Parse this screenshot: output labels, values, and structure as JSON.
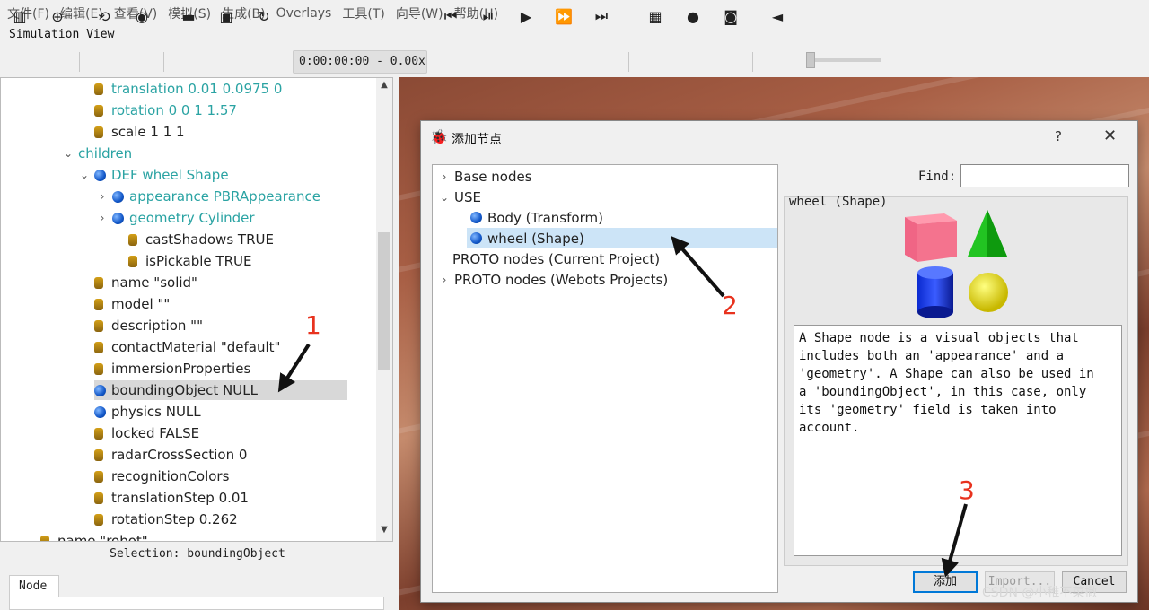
{
  "menu": [
    "文件(F)",
    "编辑(E)",
    "查看(V)",
    "模拟(S)",
    "生成(B)",
    "Overlays",
    "工具(T)",
    "向导(W)",
    "帮助(H)"
  ],
  "simulation_view_title": "Simulation View",
  "toolbar": {
    "time": "0:00:00:00 - 0.00x",
    "icons": [
      "toggle-panel-icon",
      "add-node-icon",
      "reset-view-icon",
      "eye-icon",
      "open-folder-icon",
      "save-icon",
      "reload-icon",
      "step-back-icon",
      "step-icon",
      "play-icon",
      "fast-forward-icon",
      "fastest-icon",
      "record-movie-icon",
      "record-icon",
      "screenshot-icon",
      "mute-icon"
    ]
  },
  "scene_tree": {
    "rows": [
      {
        "text": "translation 0.01 0.0975 0",
        "kind": "field",
        "teal": true
      },
      {
        "text": "rotation 0 0 1 1.57",
        "kind": "field",
        "teal": true
      },
      {
        "text": "scale 1 1 1",
        "kind": "field",
        "teal": false
      },
      {
        "text": "children",
        "kind": "chevron-open",
        "teal": true
      },
      {
        "text": "DEF wheel Shape",
        "kind": "node-open",
        "teal": true
      },
      {
        "text": "appearance PBRAppearance",
        "kind": "node-closed",
        "teal": true
      },
      {
        "text": "geometry Cylinder",
        "kind": "node-closed",
        "teal": true
      },
      {
        "text": "castShadows TRUE",
        "kind": "field",
        "teal": false
      },
      {
        "text": "isPickable TRUE",
        "kind": "field",
        "teal": false
      },
      {
        "text": "name \"solid\"",
        "kind": "field",
        "teal": false
      },
      {
        "text": "model \"\"",
        "kind": "field",
        "teal": false
      },
      {
        "text": "description \"\"",
        "kind": "field",
        "teal": false
      },
      {
        "text": "contactMaterial \"default\"",
        "kind": "field",
        "teal": false
      },
      {
        "text": "immersionProperties",
        "kind": "field",
        "teal": false
      },
      {
        "text": "boundingObject NULL",
        "kind": "node",
        "teal": false,
        "selected": true
      },
      {
        "text": "physics NULL",
        "kind": "node",
        "teal": false
      },
      {
        "text": "locked FALSE",
        "kind": "field",
        "teal": false
      },
      {
        "text": "radarCrossSection 0",
        "kind": "field",
        "teal": false
      },
      {
        "text": "recognitionColors",
        "kind": "field",
        "teal": false
      },
      {
        "text": "translationStep 0.01",
        "kind": "field",
        "teal": false
      },
      {
        "text": "rotationStep 0.262",
        "kind": "field",
        "teal": false
      },
      {
        "text": "name \"robot\"",
        "kind": "field",
        "teal": false
      }
    ]
  },
  "selection_label": "Selection: boundingObject",
  "node_tab_label": "Node",
  "dialog": {
    "title": "添加节点",
    "help": "?",
    "close": "✕",
    "list": [
      {
        "text": "Base nodes",
        "kind": "collapsed"
      },
      {
        "text": "USE",
        "kind": "expanded"
      },
      {
        "text": "Body (Transform)",
        "kind": "node"
      },
      {
        "text": "wheel (Shape)",
        "kind": "node",
        "selected": true
      },
      {
        "text": "PROTO nodes (Current Project)",
        "kind": "plain"
      },
      {
        "text": "PROTO nodes (Webots Projects)",
        "kind": "collapsed"
      }
    ],
    "find_label": "Find:",
    "find_value": "",
    "preview_name": "wheel (Shape)",
    "description": "A Shape node is a visual objects that\nincludes both an 'appearance' and a\n'geometry'. A Shape can also be used in\na 'boundingObject', in this case, only\nits 'geometry' field is taken into\naccount.",
    "buttons": {
      "add": "添加",
      "import": "Import...",
      "cancel": "Cancel"
    }
  },
  "annotations": {
    "one": "1",
    "two": "2",
    "three": "3"
  },
  "watermark": "CSDN @小稚不菜撒",
  "colors": {
    "teal": "#2aa3a3",
    "selection": "#cce4f7",
    "annotation": "#e8321e",
    "accent": "#0078d7"
  }
}
